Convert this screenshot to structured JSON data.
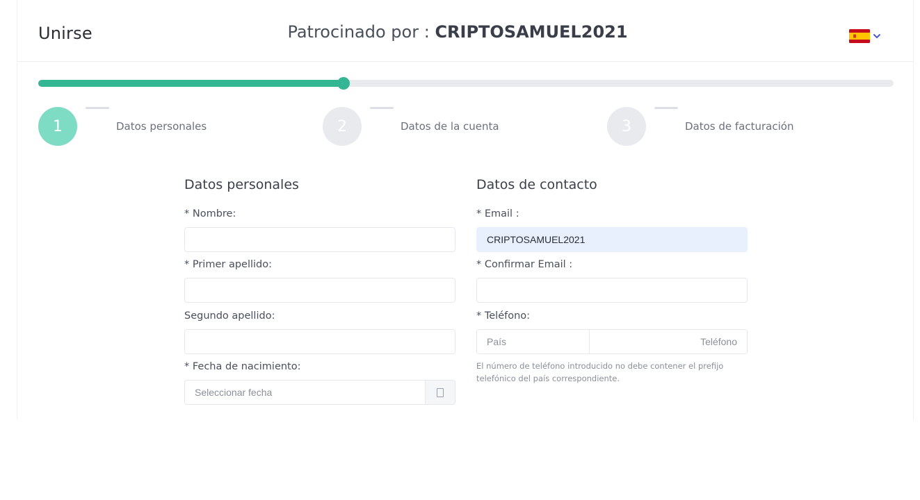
{
  "header": {
    "brand": "Unirse",
    "sponsor_prefix": "Patrocinado por : ",
    "sponsor_name": "CRIPTOSAMUEL2021",
    "language_flag": "spain-flag-icon"
  },
  "progress": {
    "fraction": 0.357,
    "color": "#34b594"
  },
  "steps": [
    {
      "number": "1",
      "label": "Datos personales",
      "active": true
    },
    {
      "number": "2",
      "label": "Datos de la cuenta",
      "active": false
    },
    {
      "number": "3",
      "label": "Datos de facturación",
      "active": false
    }
  ],
  "personal": {
    "title": "Datos personales",
    "first_name_label": "* Nombre:",
    "first_surname_label": "* Primer apellido:",
    "second_surname_label": "Segundo apellido:",
    "birthdate_label": "* Fecha de nacimiento:",
    "birthdate_placeholder": "Seleccionar fecha"
  },
  "contact": {
    "title": "Datos de contacto",
    "email_label": "* Email :",
    "email_value": "CRIPTOSAMUEL2021",
    "confirm_email_label": "* Confirmar Email :",
    "phone_label": "* Teléfono:",
    "country_placeholder": "País",
    "phone_placeholder": "Teléfono",
    "phone_hint": "El número de teléfono introducido no debe contener el prefijo telefónico del país correspondiente."
  }
}
